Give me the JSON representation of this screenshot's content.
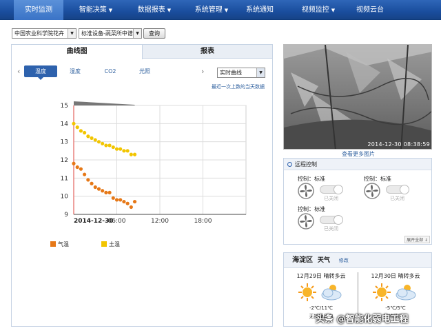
{
  "nav": {
    "items": [
      {
        "label": "实时监测",
        "caret": false,
        "active": true
      },
      {
        "label": "智能决策",
        "caret": true,
        "active": false
      },
      {
        "label": "数据报表",
        "caret": true,
        "active": false
      },
      {
        "label": "系统管理",
        "caret": true,
        "active": false
      },
      {
        "label": "系统通知",
        "caret": false,
        "active": false
      },
      {
        "label": "视频监控",
        "caret": true,
        "active": false
      },
      {
        "label": "视频云台",
        "caret": false,
        "active": false
      }
    ]
  },
  "filters": {
    "location": "中国农业科学院花卉",
    "device": "标准设备-蔬菜所中谱",
    "query_button": "查询"
  },
  "tabs": {
    "curve": "曲线图",
    "report": "报表"
  },
  "subtabs": [
    "温度",
    "湿度",
    "CO2",
    "光照"
  ],
  "mode_select": "实时曲线",
  "latest_link": "最近一次上数的当天数据",
  "chart_data": {
    "type": "line",
    "x_date_label": "2014-12-30",
    "x_ticks": [
      "06:00",
      "12:00",
      "18:00"
    ],
    "y_ticks": [
      9,
      10,
      11,
      12,
      13,
      14,
      15
    ],
    "ylim": [
      9,
      15
    ],
    "series": [
      {
        "name": "气温",
        "color": "#e67817",
        "x": [
          0.0,
          0.5,
          1.0,
          1.5,
          2.0,
          2.5,
          3.0,
          3.5,
          4.0,
          4.5,
          5.0,
          5.5,
          6.0,
          6.5,
          7.0,
          7.5,
          8.0,
          8.5
        ],
        "values": [
          11.8,
          11.6,
          11.5,
          11.2,
          10.9,
          10.7,
          10.5,
          10.4,
          10.3,
          10.2,
          10.2,
          9.9,
          9.8,
          9.8,
          9.7,
          9.6,
          9.4,
          9.7
        ]
      },
      {
        "name": "土温",
        "color": "#f2c500",
        "x": [
          0.0,
          0.5,
          1.0,
          1.5,
          2.0,
          2.5,
          3.0,
          3.5,
          4.0,
          4.5,
          5.0,
          5.5,
          6.0,
          6.5,
          7.0,
          7.5,
          8.0,
          8.5
        ],
        "values": [
          14.0,
          13.8,
          13.6,
          13.5,
          13.3,
          13.2,
          13.1,
          13.0,
          12.9,
          12.8,
          12.8,
          12.7,
          12.6,
          12.6,
          12.5,
          12.5,
          12.3,
          12.3
        ]
      }
    ]
  },
  "camera": {
    "timestamp": "2014-12-30  08:38:59",
    "more_link": "查看更多图片"
  },
  "remote": {
    "title": "远程控制",
    "controls": [
      {
        "label": "控制：标准",
        "state": "已关闭"
      },
      {
        "label": "控制：标准",
        "state": "已关闭"
      },
      {
        "label": "控制：标准",
        "state": "已关闭"
      }
    ],
    "expand_all": "展开全部 ⇓"
  },
  "weather": {
    "district": "海淀区",
    "title": "天气",
    "edit": "修改",
    "days": [
      {
        "date": "12月29日 晴转多云",
        "temp": "-2℃/11℃",
        "wind": "无持续风向"
      },
      {
        "date": "12月30日 晴转多云",
        "temp": "-5℃/5℃",
        "wind": "无持续风向"
      }
    ]
  },
  "watermark": "头条 @智能化弱电工程"
}
